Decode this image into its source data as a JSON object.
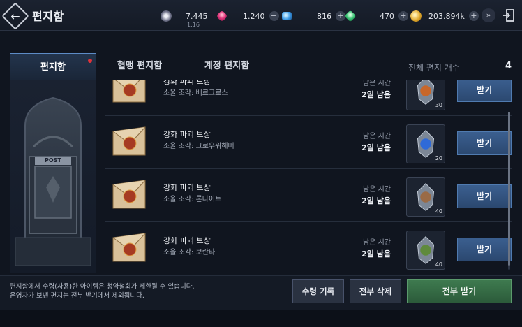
{
  "header": {
    "title": "편지함",
    "resources": [
      {
        "name": "stamina",
        "icon": "lightning-orb-icon",
        "value": "7.445",
        "sub": "1:16"
      },
      {
        "name": "red-gem",
        "icon": "red-gem-icon",
        "value": "1.240"
      },
      {
        "name": "blue-gem",
        "icon": "blue-crystal-icon",
        "value": "816"
      },
      {
        "name": "green-gem",
        "icon": "green-crystal-icon",
        "value": "470"
      },
      {
        "name": "gold",
        "icon": "gold-coin-icon",
        "value": "203.894k"
      }
    ],
    "plus_label": "+",
    "menu_icon": "chevron-double-down-icon",
    "exit_icon": "exit-door-icon"
  },
  "tabs": [
    {
      "label": "편지함",
      "active": true,
      "has_dot": true
    },
    {
      "label": "혈맹 편지함",
      "active": false
    },
    {
      "label": "계정 편지함",
      "active": false
    }
  ],
  "mail_count": {
    "label": "전체 편지 개수",
    "value": "4"
  },
  "mails": [
    {
      "title": "강화 파괴 보상",
      "subtitle": "소울 조각: 베르크로스",
      "remain_label": "남은 시간",
      "remain_value": "2일 남음",
      "item_count": "30",
      "button": "받기",
      "item_color": "#c8672a"
    },
    {
      "title": "강화 파괴 보상",
      "subtitle": "소울 조각: 크로우워해머",
      "remain_label": "남은 시간",
      "remain_value": "2일 남음",
      "item_count": "20",
      "button": "받기",
      "item_color": "#2f6ad8"
    },
    {
      "title": "강화 파괴 보상",
      "subtitle": "소울 조각: 론다이트",
      "remain_label": "남은 시간",
      "remain_value": "2일 남음",
      "item_count": "40",
      "button": "받기",
      "item_color": "#9a6b46"
    },
    {
      "title": "강화 파괴 보상",
      "subtitle": "소울 조각: 보란타",
      "remain_label": "남은 시간",
      "remain_value": "2일 남음",
      "item_count": "40",
      "button": "받기",
      "item_color": "#5f8a3c"
    }
  ],
  "mailbox_art": {
    "sign": "POST"
  },
  "footer": {
    "notice_line1": "편지함에서 수령(사용)한 아이템은 청약철회가 제한될 수 있습니다.",
    "notice_line2": "운영자가 보낸 편지는 전부 받기에서 제외됩니다.",
    "history_button": "수령 기록",
    "delete_all_button": "전부 삭제",
    "receive_all_button": "전부 받기"
  }
}
